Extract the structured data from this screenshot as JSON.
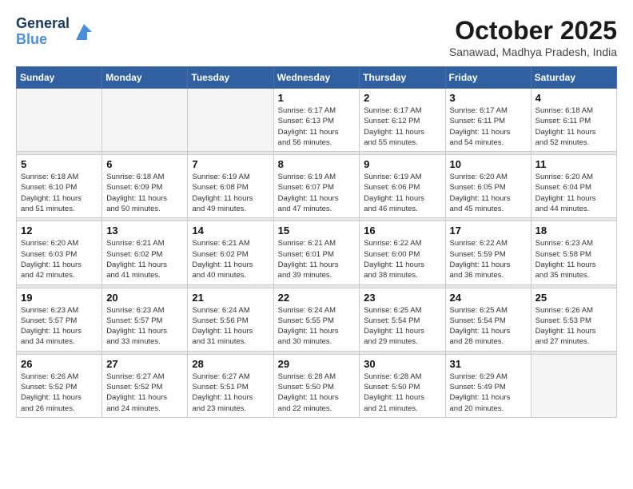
{
  "logo": {
    "line1": "General",
    "line2": "Blue",
    "arrow_color": "#4a90d9"
  },
  "header": {
    "month": "October 2025",
    "location": "Sanawad, Madhya Pradesh, India"
  },
  "weekdays": [
    "Sunday",
    "Monday",
    "Tuesday",
    "Wednesday",
    "Thursday",
    "Friday",
    "Saturday"
  ],
  "weeks": [
    [
      {
        "day": "",
        "info": ""
      },
      {
        "day": "",
        "info": ""
      },
      {
        "day": "",
        "info": ""
      },
      {
        "day": "1",
        "info": "Sunrise: 6:17 AM\nSunset: 6:13 PM\nDaylight: 11 hours\nand 56 minutes."
      },
      {
        "day": "2",
        "info": "Sunrise: 6:17 AM\nSunset: 6:12 PM\nDaylight: 11 hours\nand 55 minutes."
      },
      {
        "day": "3",
        "info": "Sunrise: 6:17 AM\nSunset: 6:11 PM\nDaylight: 11 hours\nand 54 minutes."
      },
      {
        "day": "4",
        "info": "Sunrise: 6:18 AM\nSunset: 6:11 PM\nDaylight: 11 hours\nand 52 minutes."
      }
    ],
    [
      {
        "day": "5",
        "info": "Sunrise: 6:18 AM\nSunset: 6:10 PM\nDaylight: 11 hours\nand 51 minutes."
      },
      {
        "day": "6",
        "info": "Sunrise: 6:18 AM\nSunset: 6:09 PM\nDaylight: 11 hours\nand 50 minutes."
      },
      {
        "day": "7",
        "info": "Sunrise: 6:19 AM\nSunset: 6:08 PM\nDaylight: 11 hours\nand 49 minutes."
      },
      {
        "day": "8",
        "info": "Sunrise: 6:19 AM\nSunset: 6:07 PM\nDaylight: 11 hours\nand 47 minutes."
      },
      {
        "day": "9",
        "info": "Sunrise: 6:19 AM\nSunset: 6:06 PM\nDaylight: 11 hours\nand 46 minutes."
      },
      {
        "day": "10",
        "info": "Sunrise: 6:20 AM\nSunset: 6:05 PM\nDaylight: 11 hours\nand 45 minutes."
      },
      {
        "day": "11",
        "info": "Sunrise: 6:20 AM\nSunset: 6:04 PM\nDaylight: 11 hours\nand 44 minutes."
      }
    ],
    [
      {
        "day": "12",
        "info": "Sunrise: 6:20 AM\nSunset: 6:03 PM\nDaylight: 11 hours\nand 42 minutes."
      },
      {
        "day": "13",
        "info": "Sunrise: 6:21 AM\nSunset: 6:02 PM\nDaylight: 11 hours\nand 41 minutes."
      },
      {
        "day": "14",
        "info": "Sunrise: 6:21 AM\nSunset: 6:02 PM\nDaylight: 11 hours\nand 40 minutes."
      },
      {
        "day": "15",
        "info": "Sunrise: 6:21 AM\nSunset: 6:01 PM\nDaylight: 11 hours\nand 39 minutes."
      },
      {
        "day": "16",
        "info": "Sunrise: 6:22 AM\nSunset: 6:00 PM\nDaylight: 11 hours\nand 38 minutes."
      },
      {
        "day": "17",
        "info": "Sunrise: 6:22 AM\nSunset: 5:59 PM\nDaylight: 11 hours\nand 36 minutes."
      },
      {
        "day": "18",
        "info": "Sunrise: 6:23 AM\nSunset: 5:58 PM\nDaylight: 11 hours\nand 35 minutes."
      }
    ],
    [
      {
        "day": "19",
        "info": "Sunrise: 6:23 AM\nSunset: 5:57 PM\nDaylight: 11 hours\nand 34 minutes."
      },
      {
        "day": "20",
        "info": "Sunrise: 6:23 AM\nSunset: 5:57 PM\nDaylight: 11 hours\nand 33 minutes."
      },
      {
        "day": "21",
        "info": "Sunrise: 6:24 AM\nSunset: 5:56 PM\nDaylight: 11 hours\nand 31 minutes."
      },
      {
        "day": "22",
        "info": "Sunrise: 6:24 AM\nSunset: 5:55 PM\nDaylight: 11 hours\nand 30 minutes."
      },
      {
        "day": "23",
        "info": "Sunrise: 6:25 AM\nSunset: 5:54 PM\nDaylight: 11 hours\nand 29 minutes."
      },
      {
        "day": "24",
        "info": "Sunrise: 6:25 AM\nSunset: 5:54 PM\nDaylight: 11 hours\nand 28 minutes."
      },
      {
        "day": "25",
        "info": "Sunrise: 6:26 AM\nSunset: 5:53 PM\nDaylight: 11 hours\nand 27 minutes."
      }
    ],
    [
      {
        "day": "26",
        "info": "Sunrise: 6:26 AM\nSunset: 5:52 PM\nDaylight: 11 hours\nand 26 minutes."
      },
      {
        "day": "27",
        "info": "Sunrise: 6:27 AM\nSunset: 5:52 PM\nDaylight: 11 hours\nand 24 minutes."
      },
      {
        "day": "28",
        "info": "Sunrise: 6:27 AM\nSunset: 5:51 PM\nDaylight: 11 hours\nand 23 minutes."
      },
      {
        "day": "29",
        "info": "Sunrise: 6:28 AM\nSunset: 5:50 PM\nDaylight: 11 hours\nand 22 minutes."
      },
      {
        "day": "30",
        "info": "Sunrise: 6:28 AM\nSunset: 5:50 PM\nDaylight: 11 hours\nand 21 minutes."
      },
      {
        "day": "31",
        "info": "Sunrise: 6:29 AM\nSunset: 5:49 PM\nDaylight: 11 hours\nand 20 minutes."
      },
      {
        "day": "",
        "info": ""
      }
    ]
  ]
}
